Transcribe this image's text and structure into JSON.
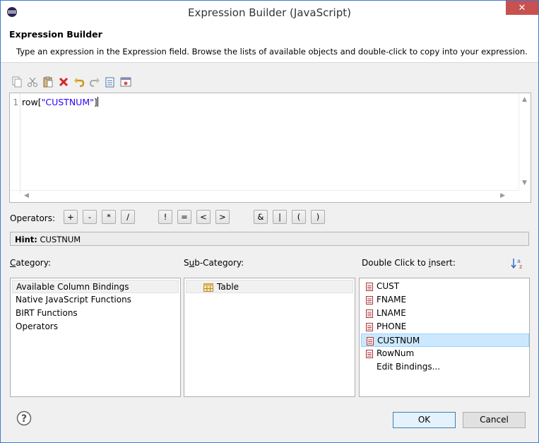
{
  "window": {
    "title": "Expression Builder (JavaScript)"
  },
  "header": {
    "title": "Expression Builder",
    "description": "Type an expression in the Expression field. Browse the lists of available objects and double-click to copy into your expression."
  },
  "editor": {
    "line_number": "1",
    "code_prefix": "row[",
    "code_string": "\"CUSTNUM\"",
    "code_suffix": "]"
  },
  "operators": {
    "label": "Operators:",
    "items": [
      "+",
      "-",
      "*",
      "/",
      "!",
      "=",
      "<",
      ">",
      "&",
      "|",
      "(",
      ")"
    ]
  },
  "hint": {
    "label": "Hint:",
    "text": "CUSTNUM"
  },
  "category": {
    "label_underlined": "C",
    "label_rest": "ategory:",
    "items": [
      "Available Column Bindings",
      "Native JavaScript Functions",
      "BIRT Functions",
      "Operators"
    ]
  },
  "subcategory": {
    "label_pre": "S",
    "label_underlined": "u",
    "label_rest": "b-Category:",
    "items": [
      "Table"
    ]
  },
  "insert": {
    "label_pre": "Double Click to ",
    "label_underlined": "i",
    "label_rest": "nsert:",
    "items": [
      "CUST",
      "FNAME",
      "LNAME",
      "PHONE",
      "CUSTNUM",
      "RowNum"
    ],
    "edit_bindings": "Edit Bindings..."
  },
  "buttons": {
    "ok": "OK",
    "cancel": "Cancel"
  },
  "colors": {
    "selection": "#cce8ff",
    "string": "#2a00ff",
    "close": "#c75050"
  }
}
